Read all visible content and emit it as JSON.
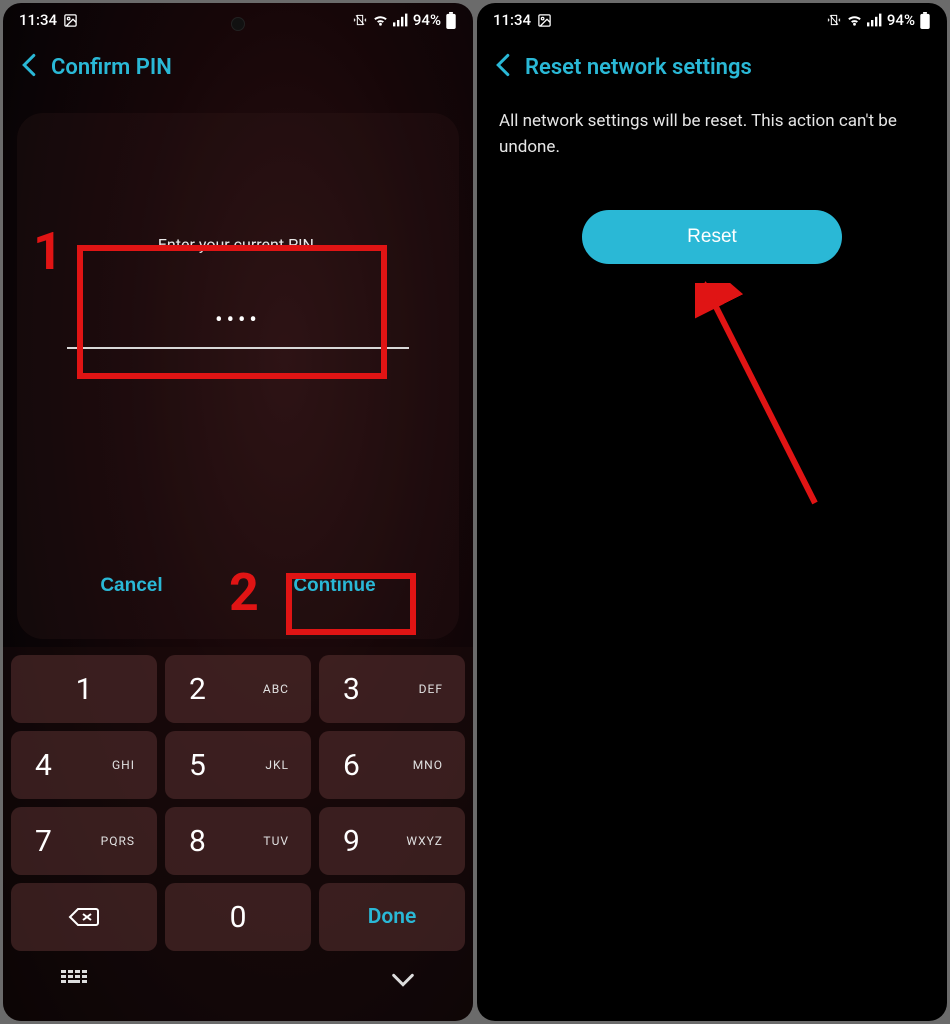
{
  "status": {
    "time": "11:34",
    "battery_text": "94%"
  },
  "left": {
    "header_title": "Confirm PIN",
    "pin_prompt": "Enter your current PIN.",
    "pin_masked": "••••",
    "cancel_label": "Cancel",
    "continue_label": "Continue",
    "keypad": {
      "keys": [
        {
          "num": "1",
          "letters": ""
        },
        {
          "num": "2",
          "letters": "ABC"
        },
        {
          "num": "3",
          "letters": "DEF"
        },
        {
          "num": "4",
          "letters": "GHI"
        },
        {
          "num": "5",
          "letters": "JKL"
        },
        {
          "num": "6",
          "letters": "MNO"
        },
        {
          "num": "7",
          "letters": "PQRS"
        },
        {
          "num": "8",
          "letters": "TUV"
        },
        {
          "num": "9",
          "letters": "WXYZ"
        }
      ],
      "zero": "0",
      "done_label": "Done"
    },
    "annotations": {
      "num1": "1",
      "num2": "2"
    }
  },
  "right": {
    "header_title": "Reset network settings",
    "description": "All network settings will be reset. This action can't be undone.",
    "reset_label": "Reset"
  }
}
